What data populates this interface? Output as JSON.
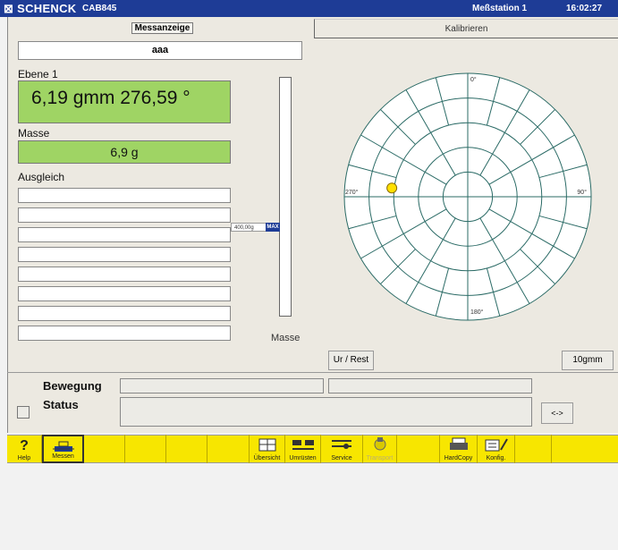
{
  "titlebar": {
    "brand": "SCHENCK",
    "model": "CAB845",
    "station": "Meßstation 1",
    "time": "16:02:27"
  },
  "tabs": [
    {
      "label": "Messanzeige",
      "active": true
    },
    {
      "label": "Kalibrieren",
      "active": false
    }
  ],
  "rotor_name": "aaa",
  "ebene": {
    "label": "Ebene 1",
    "value": "6,19 gmm 276,59 °"
  },
  "masse": {
    "label": "Masse",
    "value": "6,9 g"
  },
  "ausgleich": {
    "label": "Ausgleich",
    "rows": [
      "",
      "",
      "",
      "",
      "",
      "",
      "",
      ""
    ]
  },
  "gauge": {
    "marker_text": "400,00g",
    "max_label": "MAX",
    "caption": "Masse",
    "level": 0
  },
  "polar": {
    "angle_labels": {
      "top": "0°",
      "right": "90°",
      "bottom": "180°",
      "left": "270°"
    },
    "point": {
      "angle_deg": 276.59,
      "magnitude_gmm": 6.19
    },
    "point_color": "#ffe000",
    "range_label": "10gmm"
  },
  "buttons": {
    "ur_rest": "Ur / Rest",
    "range": "10gmm",
    "arrows": "<->"
  },
  "bewegung": {
    "label": "Bewegung",
    "field1": "",
    "field2": ""
  },
  "status": {
    "label": "Status",
    "text": ""
  },
  "toolbar": [
    {
      "label": "Help",
      "icon": "question-icon",
      "active": false,
      "enabled": true
    },
    {
      "label": "Messen",
      "icon": "measure-icon",
      "active": true,
      "enabled": true
    },
    {
      "label": "",
      "icon": "",
      "active": false,
      "enabled": true
    },
    {
      "label": "",
      "icon": "",
      "active": false,
      "enabled": true
    },
    {
      "label": "",
      "icon": "",
      "active": false,
      "enabled": true
    },
    {
      "label": "",
      "icon": "",
      "active": false,
      "enabled": true
    },
    {
      "label": "Übersicht",
      "icon": "overview-icon",
      "active": false,
      "enabled": true
    },
    {
      "label": "Umrüsten",
      "icon": "changeover-icon",
      "active": false,
      "enabled": true
    },
    {
      "label": "Service",
      "icon": "service-icon",
      "active": false,
      "enabled": true
    },
    {
      "label": "Transport",
      "icon": "transport-icon",
      "active": false,
      "enabled": false
    },
    {
      "label": "",
      "icon": "",
      "active": false,
      "enabled": true
    },
    {
      "label": "HardCopy",
      "icon": "printer-icon",
      "active": false,
      "enabled": true
    },
    {
      "label": "Konfig.",
      "icon": "config-icon",
      "active": false,
      "enabled": true
    },
    {
      "label": "",
      "icon": "",
      "active": false,
      "enabled": true
    }
  ]
}
